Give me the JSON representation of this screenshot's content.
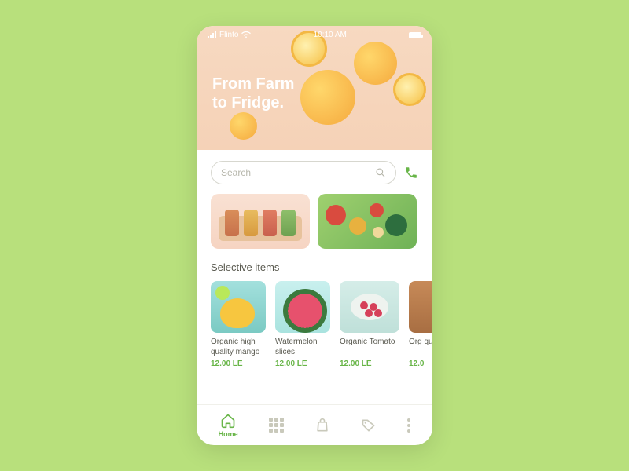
{
  "status": {
    "carrier": "Flinto",
    "time": "10:10 AM"
  },
  "hero": {
    "title": "From Farm\nto Fridge."
  },
  "search": {
    "placeholder": "Search"
  },
  "section": {
    "selective_label": "Selective items"
  },
  "items": [
    {
      "name": "Organic high quality mango",
      "price": "12.00 LE"
    },
    {
      "name": "Watermelon slices",
      "price": "12.00 LE"
    },
    {
      "name": "Organic Tomato",
      "price": "12.00 LE"
    },
    {
      "name": "Org qua",
      "price": "12.0"
    }
  ],
  "tabs": {
    "home": "Home"
  }
}
